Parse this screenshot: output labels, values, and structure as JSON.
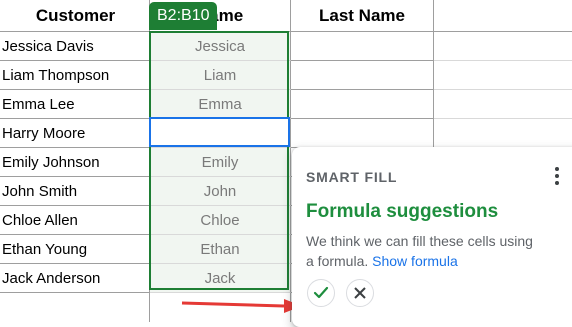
{
  "headers": {
    "col_a": "Customer",
    "col_b": "Name",
    "col_c": "Last Name"
  },
  "rows": [
    {
      "customer": "Jessica Davis",
      "suggestion": "Jessica"
    },
    {
      "customer": "Liam Thompson",
      "suggestion": "Liam"
    },
    {
      "customer": "Emma Lee",
      "suggestion": "Emma"
    },
    {
      "customer": "Harry Moore",
      "suggestion": ""
    },
    {
      "customer": "Emily Johnson",
      "suggestion": "Emily"
    },
    {
      "customer": "John Smith",
      "suggestion": "John"
    },
    {
      "customer": "Chloe Allen",
      "suggestion": "Chloe"
    },
    {
      "customer": "Ethan Young",
      "suggestion": "Ethan"
    },
    {
      "customer": "Jack Anderson",
      "suggestion": "Jack"
    }
  ],
  "range_label": "B2:B10",
  "smart_fill": {
    "header": "SMART FILL",
    "title": "Formula suggestions",
    "body": "We think we can fill these cells using a formula.",
    "link": "Show formula"
  },
  "icons": {
    "accept": "checkmark-icon",
    "reject": "close-icon",
    "menu": "more-vert-icon",
    "pointer": "red-arrow-icon"
  },
  "colors": {
    "accent_green": "#1e8e3e",
    "range_green": "#1e7e34",
    "active_blue": "#1a73e8",
    "arrow_red": "#e53935"
  }
}
